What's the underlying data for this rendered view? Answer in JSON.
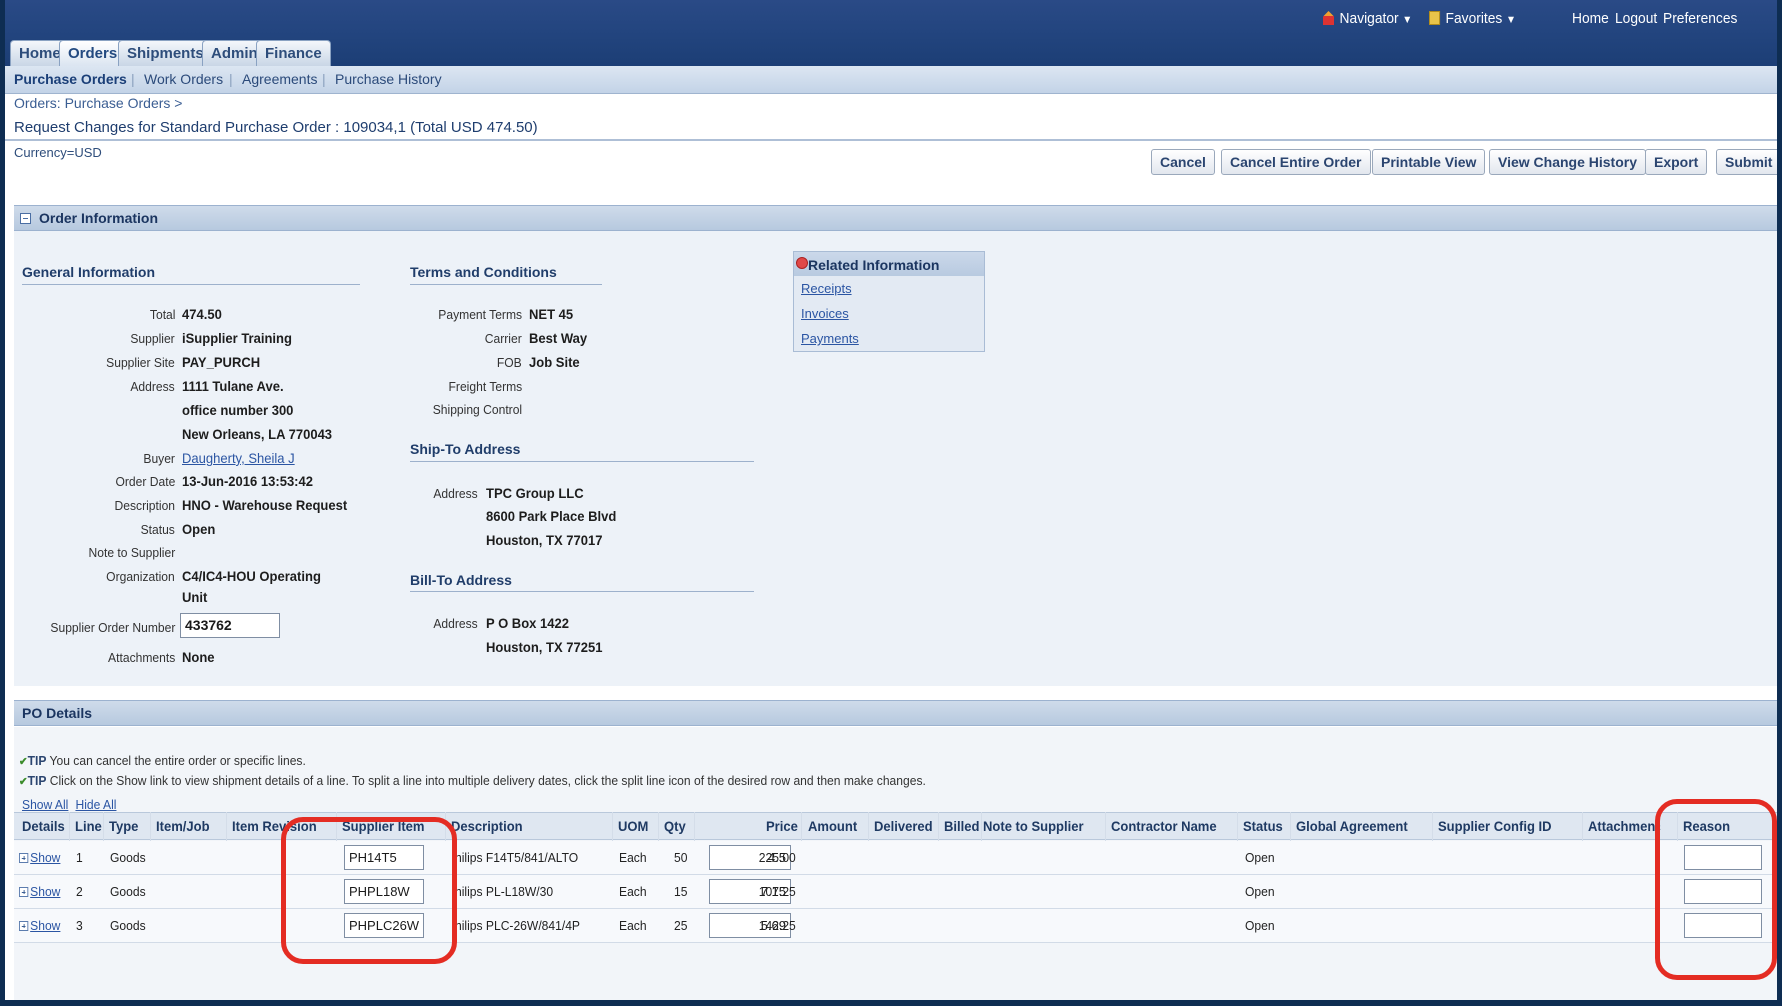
{
  "global_nav": {
    "navigator": "Navigator",
    "favorites": "Favorites",
    "home": "Home",
    "logout": "Logout",
    "preferences": "Preferences"
  },
  "tabs": [
    "Home",
    "Orders",
    "Shipments",
    "Admin",
    "Finance"
  ],
  "subtabs": [
    "Purchase Orders",
    "Work Orders",
    "Agreements",
    "Purchase History"
  ],
  "breadcrumb": "Orders: Purchase Orders  >",
  "page_title": "Request Changes for Standard Purchase Order : 109034,1 (Total USD 474.50)",
  "currency": "Currency=USD",
  "buttons": {
    "cancel": "Cancel",
    "cancel_entire": "Cancel Entire Order",
    "printable": "Printable View",
    "view_history": "View Change History",
    "export": "Export",
    "submit": "Submit"
  },
  "order_info": {
    "header": "Order Information",
    "general": {
      "title": "General Information",
      "total_label": "Total",
      "total": "474.50",
      "supplier_label": "Supplier",
      "supplier": "iSupplier Training",
      "site_label": "Supplier Site",
      "site": "PAY_PURCH",
      "address_label": "Address",
      "address1": "1111 Tulane Ave.",
      "address2": "office number 300",
      "address3": "New Orleans, LA 770043",
      "buyer_label": "Buyer",
      "buyer": "Daugherty, Sheila J",
      "order_date_label": "Order Date",
      "order_date": "13-Jun-2016 13:53:42",
      "desc_label": "Description",
      "desc": "HNO - Warehouse Request",
      "status_label": "Status",
      "status": "Open",
      "note_label": "Note to Supplier",
      "org_label": "Organization",
      "org1": "C4/IC4-HOU Operating",
      "org2": "Unit",
      "son_label": "Supplier Order Number",
      "son": "433762",
      "attach_label": "Attachments",
      "attach": "None"
    },
    "terms": {
      "title": "Terms and Conditions",
      "payment_label": "Payment Terms",
      "payment": "NET 45",
      "carrier_label": "Carrier",
      "carrier": "Best Way",
      "fob_label": "FOB",
      "fob": "Job Site",
      "freight_label": "Freight Terms",
      "shipping_label": "Shipping Control"
    },
    "ship_to": {
      "title": "Ship-To Address",
      "address_label": "Address",
      "line1": "TPC Group LLC",
      "line2": "8600 Park Place Blvd",
      "line3": "Houston, TX 77017"
    },
    "bill_to": {
      "title": "Bill-To Address",
      "address_label": "Address",
      "line1": "P O Box 1422",
      "line2": "Houston, TX 77251"
    },
    "related": {
      "title": "Related Information",
      "links": [
        "Receipts",
        "Invoices",
        "Payments"
      ]
    }
  },
  "po_details": {
    "header": "PO Details",
    "tip_label": "TIP",
    "tip1": "You can cancel the entire order or specific lines.",
    "tip2": "Click on the Show link to view shipment details of a line. To split a line into multiple delivery dates, click the split line icon of the desired row and then make changes.",
    "show_all": "Show All",
    "hide_all": "Hide All",
    "columns": [
      "Details",
      "Line",
      "Type",
      "Item/Job",
      "Item Revision",
      "Supplier Item",
      "Description",
      "UOM",
      "Qty",
      "Price",
      "Amount",
      "Delivered",
      "Billed",
      "Note to Supplier",
      "Contractor Name",
      "Status",
      "Global Agreement",
      "Supplier Config ID",
      "Attachments",
      "Reason"
    ],
    "rows": [
      {
        "details": "Show",
        "line": "1",
        "type": "Goods",
        "supplier_item": "PH14T5",
        "description": "hilips F14T5/841/ALTO",
        "uom": "Each",
        "qty": "50",
        "price": "4.5",
        "amount": "225.00",
        "status": "Open",
        "reason": ""
      },
      {
        "details": "Show",
        "line": "2",
        "type": "Goods",
        "supplier_item": "PHPL18W",
        "description": "hilips PL-L18W/30",
        "uom": "Each",
        "qty": "15",
        "price": "7.15",
        "amount": "107.25",
        "status": "Open",
        "reason": ""
      },
      {
        "details": "Show",
        "line": "3",
        "type": "Goods",
        "supplier_item": "PHPLC26W",
        "description": "hilips PLC-26W/841/4P",
        "uom": "Each",
        "qty": "25",
        "price": "5.69",
        "amount": "142.25",
        "status": "Open",
        "reason": ""
      }
    ]
  },
  "colors": {
    "highlight": "#e42c23",
    "brand_bar": "#23457f",
    "link": "#2b55a3"
  }
}
